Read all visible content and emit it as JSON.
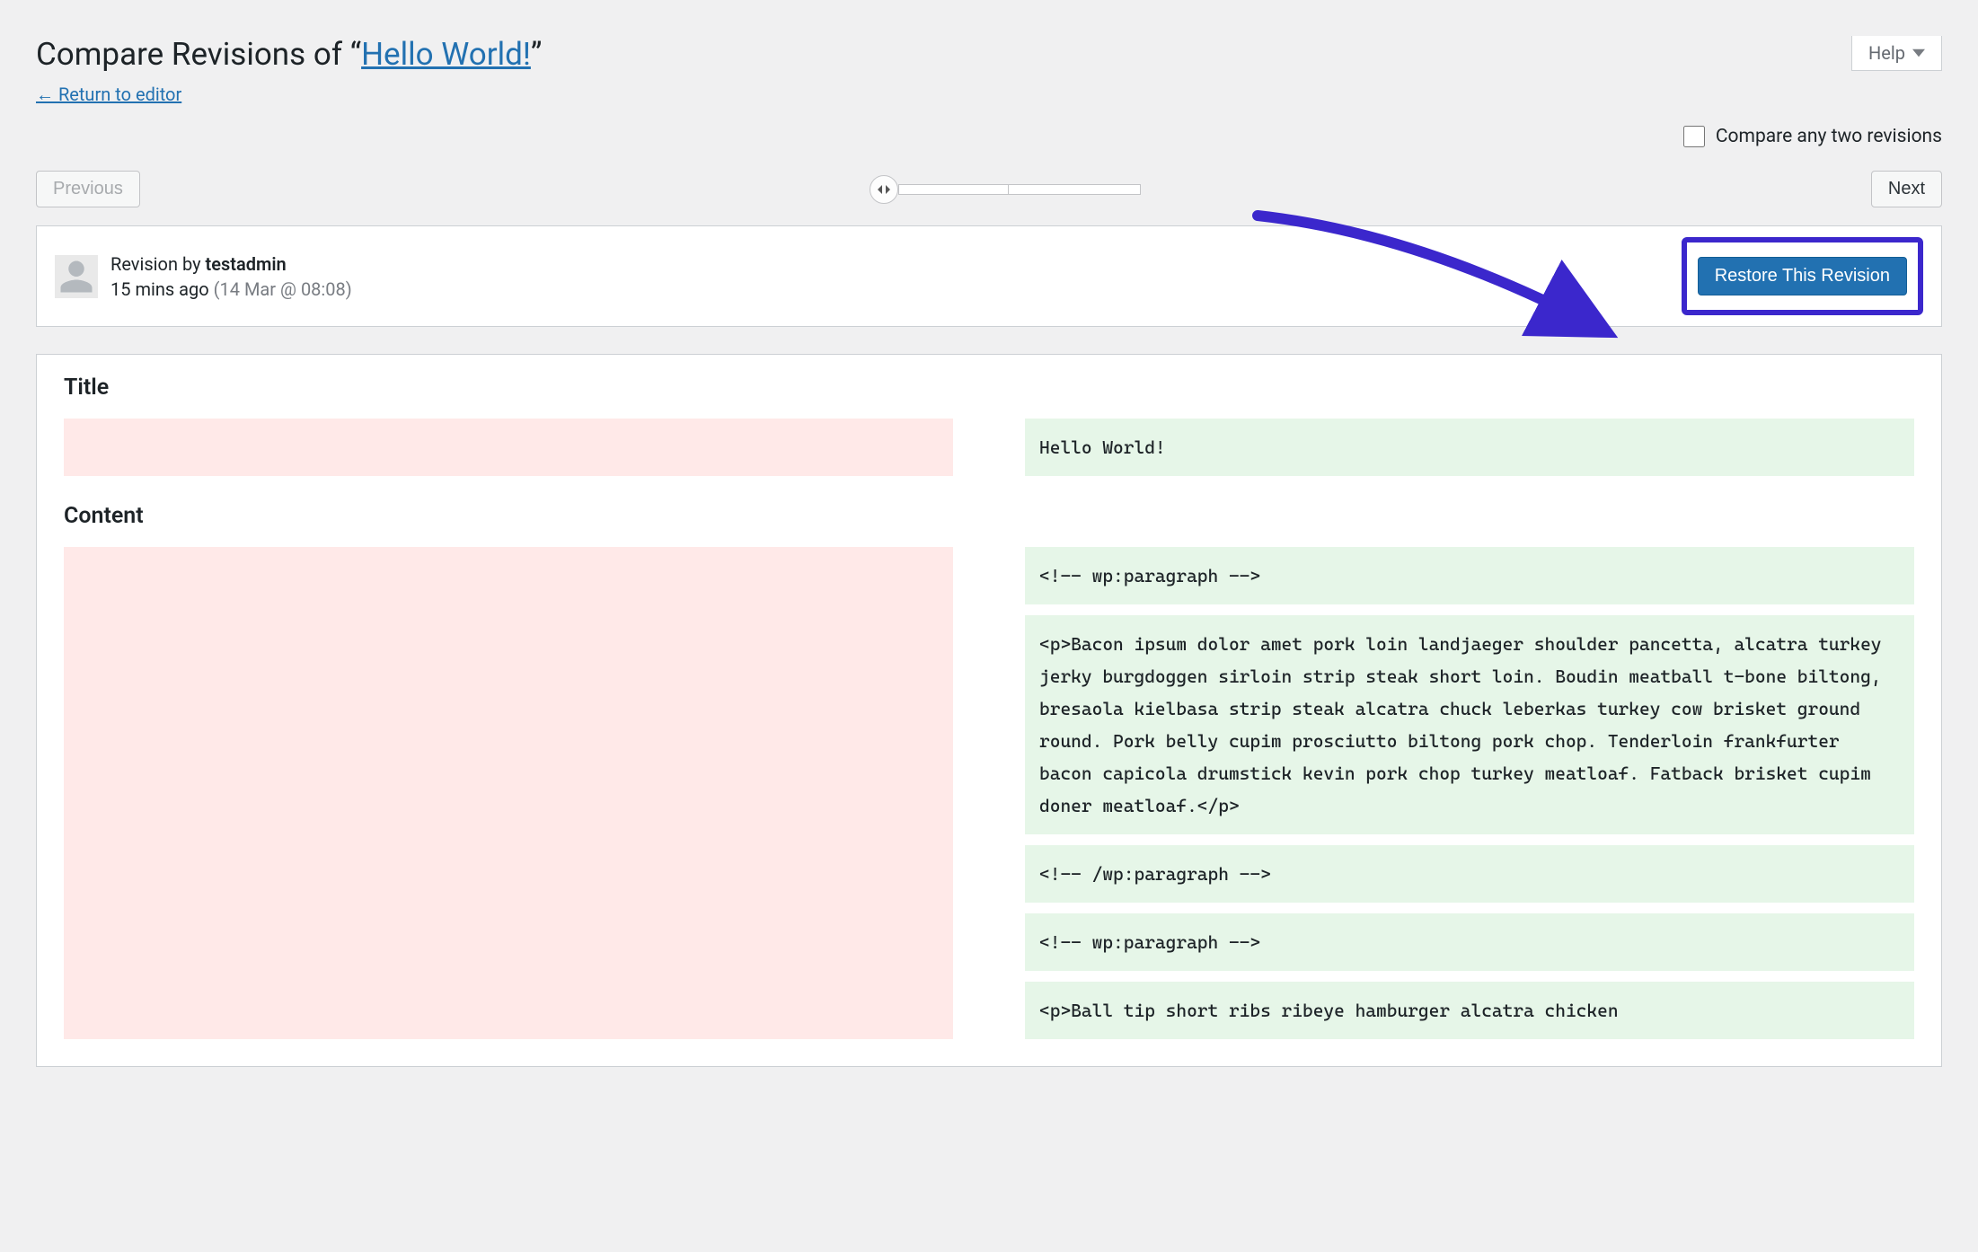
{
  "help_label": "Help",
  "heading_prefix": "Compare Revisions of “",
  "heading_link": "Hello World!",
  "heading_suffix": "”",
  "return_link": "← Return to editor",
  "compare_checkbox_label": "Compare any two revisions",
  "prev_label": "Previous",
  "next_label": "Next",
  "revision": {
    "by_label": "Revision by ",
    "author": "testadmin",
    "time_ago": "15 mins ago",
    "timestamp": "(14 Mar @ 08:08)"
  },
  "restore_label": "Restore This Revision",
  "diff": {
    "title_heading": "Title",
    "title_added": "Hello World!",
    "content_heading": "Content",
    "content_added": [
      "<!-- wp:paragraph -->",
      "<p>Bacon ipsum dolor amet pork loin landjaeger shoulder pancetta, alcatra turkey jerky burgdoggen sirloin strip steak short loin. Boudin meatball t-bone biltong, bresaola kielbasa strip steak alcatra chuck leberkas turkey cow brisket ground round. Pork belly cupim prosciutto biltong pork chop. Tenderloin frankfurter bacon capicola drumstick kevin pork chop turkey meatloaf. Fatback brisket cupim doner meatloaf.</p>",
      "<!-- /wp:paragraph -->",
      "<!-- wp:paragraph -->",
      "<p>Ball tip short ribs ribeye hamburger alcatra chicken"
    ]
  }
}
